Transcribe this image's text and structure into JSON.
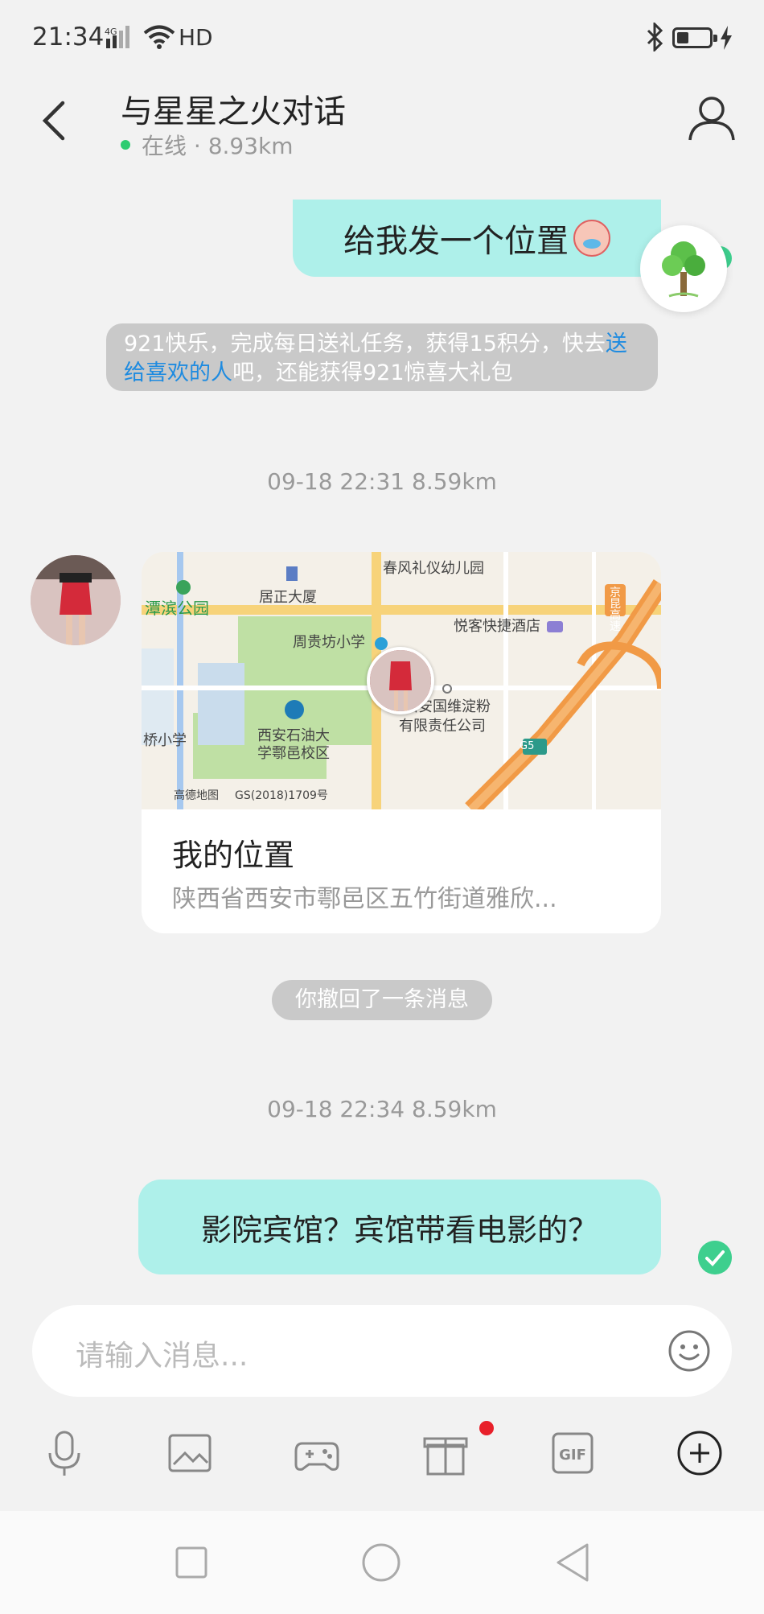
{
  "status_bar": {
    "time": "21:34",
    "network": "4G",
    "hd": "HD"
  },
  "header": {
    "title": "与星星之火对话",
    "status": "在线 · 8.93km"
  },
  "messages": {
    "outgoing_1": "给我发一个位置",
    "notice_prefix": "921快乐，完成每日送礼任务，获得15积分，快去",
    "notice_link": "送给喜欢的人",
    "notice_suffix": "吧，还能获得921惊喜大礼包",
    "timestamp_1": "09-18 22:31  8.59km",
    "location_card": {
      "title": "我的位置",
      "address": "陕西省西安市鄠邑区五竹街道雅欣...",
      "map_labels": {
        "kindergarten": "春风礼仪幼儿园",
        "park": "潭滨公园",
        "building": "居正大厦",
        "hotel": "悦客快捷酒店",
        "school": "周贵坊小学",
        "campus_line1": "西安石油大",
        "campus_line2": "学鄠邑校区",
        "company_line1": "西安国维淀粉",
        "company_line2": "有限责任公司",
        "bridge_school": "桥小学",
        "expressway": "京昆高速",
        "road_code": "G5",
        "map_brand": "高德地图",
        "map_license": "GS(2018)1709号"
      }
    },
    "recall_notice": "你撤回了一条消息",
    "timestamp_2": "09-18 22:34  8.59km",
    "outgoing_2": "影院宾馆？宾馆带看电影的？"
  },
  "input": {
    "placeholder": "请输入消息..."
  },
  "toolbar": {
    "gif_label": "GIF"
  },
  "colors": {
    "bubble_out": "#aef0ea",
    "online": "#2ecc71",
    "check": "#3ecf8e",
    "link": "#1e8be0",
    "badge_red": "#e8202a"
  }
}
